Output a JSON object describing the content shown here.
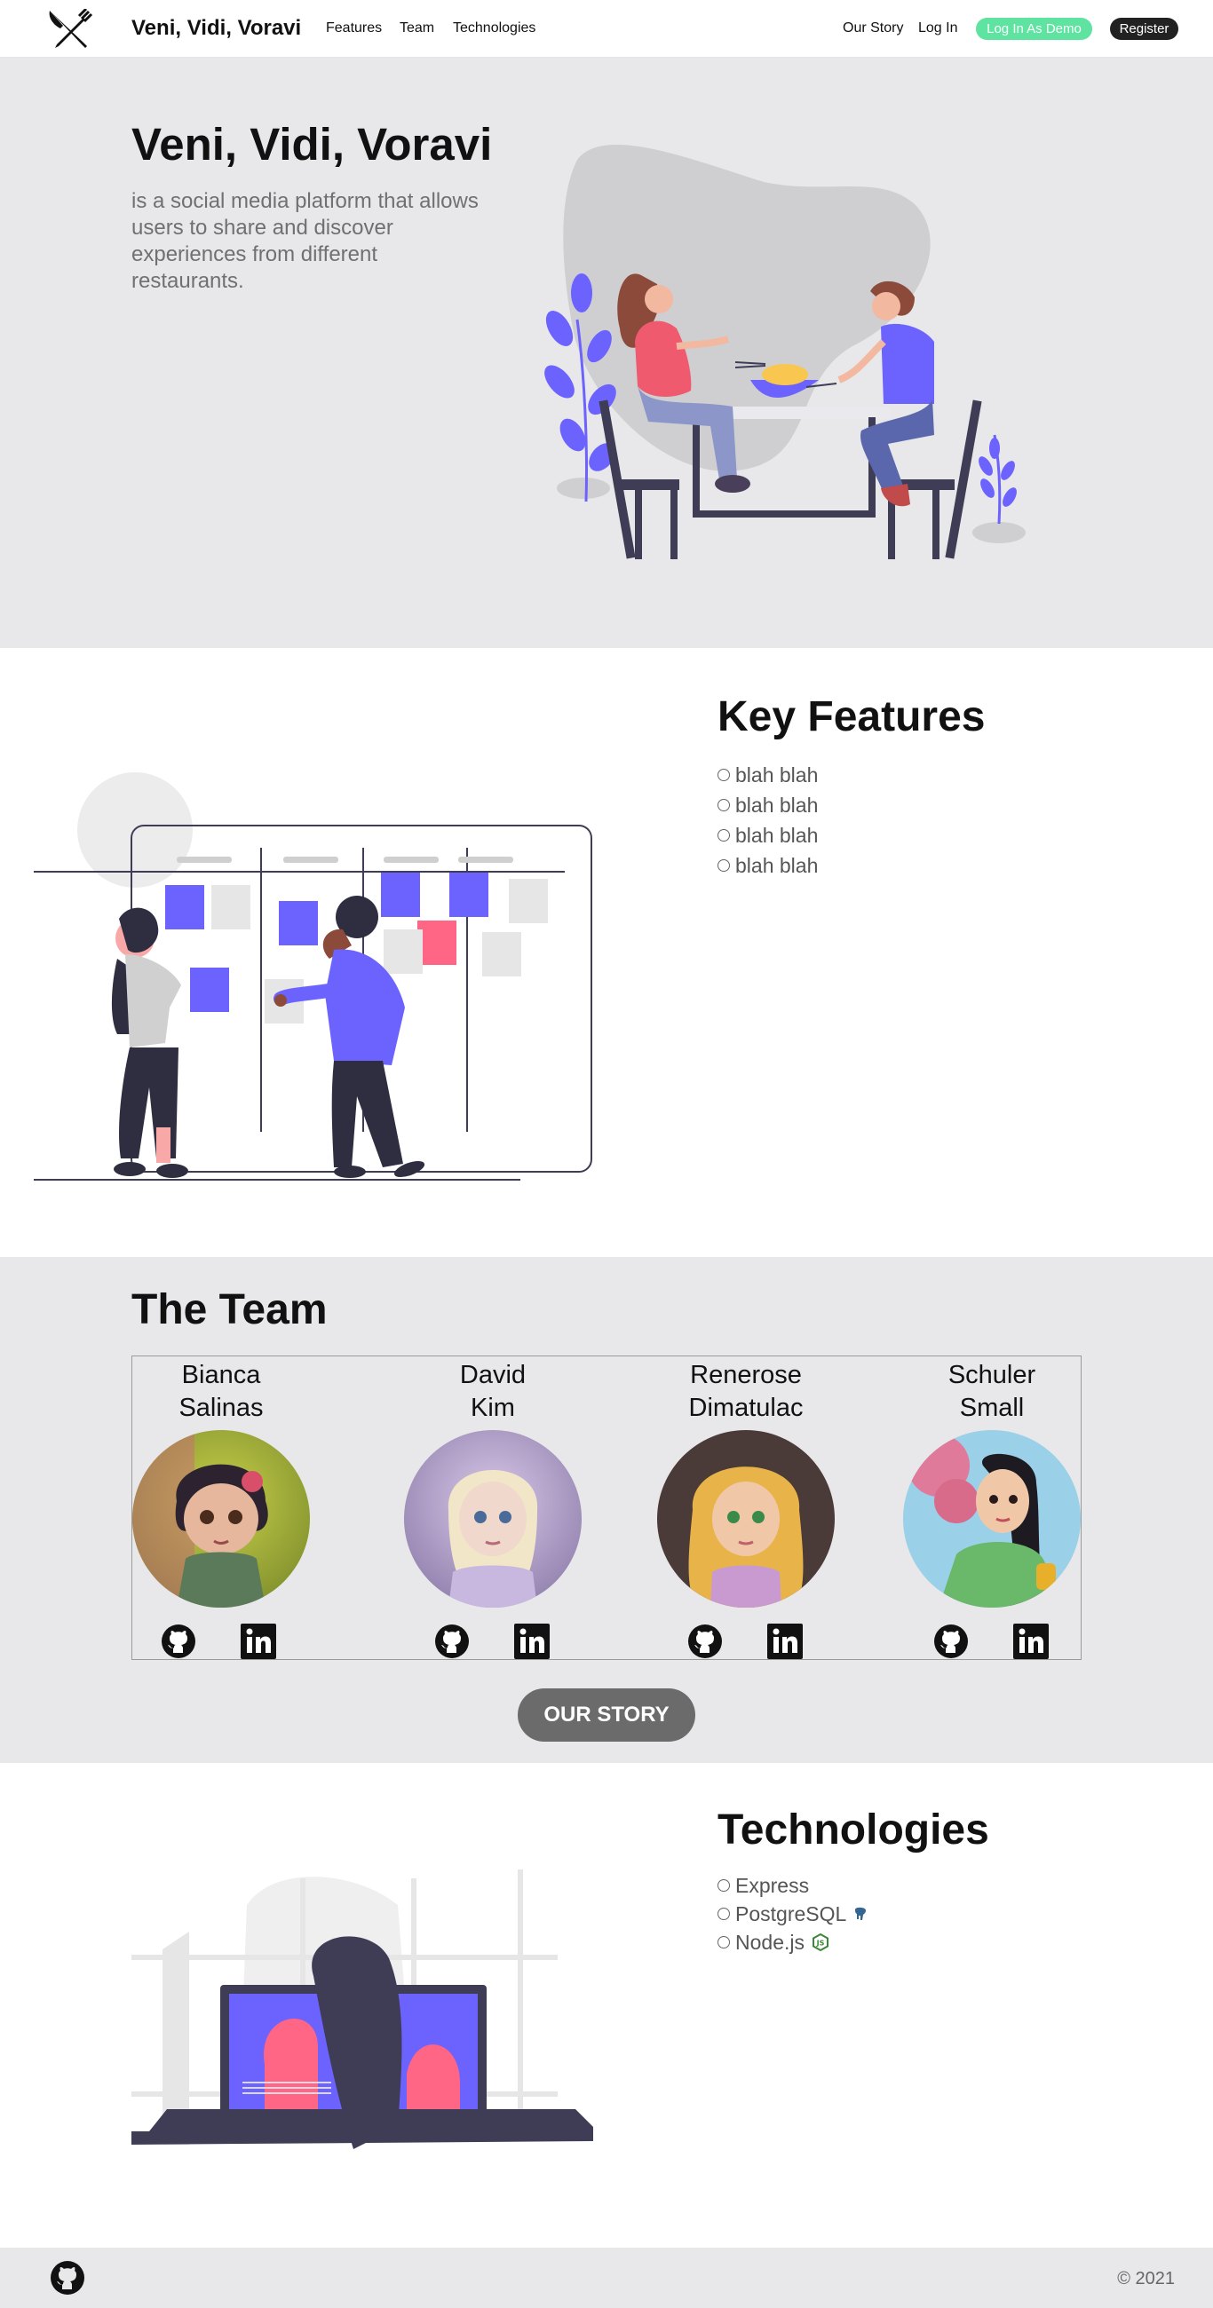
{
  "nav": {
    "brand": "Veni, Vidi, Voravi",
    "links": [
      "Features",
      "Team",
      "Technologies"
    ],
    "our_story": "Our Story",
    "login": "Log In",
    "demo": "Log In As Demo",
    "register": "Register",
    "logo_icon": "fork-knife-icon"
  },
  "hero": {
    "title": "Veni, Vidi, Voravi",
    "subtitle": "is a social media platform that allows users to share and discover experiences from different restaurants."
  },
  "features": {
    "title": "Key Features",
    "items": [
      "blah blah",
      "blah blah",
      "blah blah",
      "blah blah"
    ]
  },
  "team": {
    "title": "The Team",
    "members": [
      {
        "first": "Bianca",
        "last": "Salinas"
      },
      {
        "first": "David",
        "last": "Kim"
      },
      {
        "first": "Renerose",
        "last": "Dimatulac"
      },
      {
        "first": "Schuler",
        "last": "Small"
      }
    ],
    "button": "OUR STORY"
  },
  "tech": {
    "title": "Technologies",
    "items": [
      "Express",
      "PostgreSQL",
      "Node.js"
    ]
  },
  "footer": {
    "copyright": "© 2021"
  },
  "colors": {
    "accent": "#6c63ff",
    "demo_green": "#5ee3a1",
    "pink": "#ff6584",
    "section_gray": "#e8e8ea"
  }
}
